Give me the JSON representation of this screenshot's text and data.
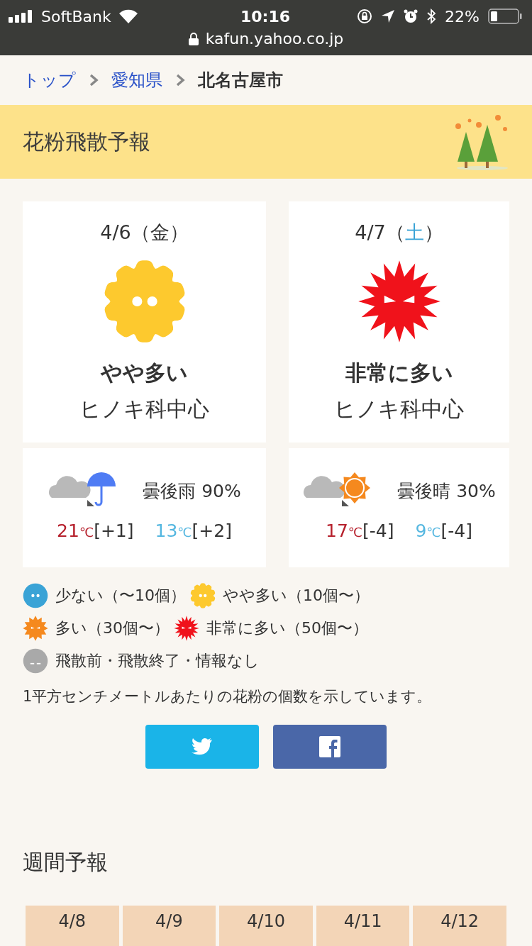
{
  "status_bar": {
    "carrier": "SoftBank",
    "time": "10:16",
    "battery": "22%"
  },
  "address_bar": {
    "url": "kafun.yahoo.co.jp"
  },
  "breadcrumb": [
    {
      "label": "トップ",
      "kind": "link"
    },
    {
      "label": "愛知県",
      "kind": "link"
    },
    {
      "label": "北名古屋市",
      "kind": "current"
    }
  ],
  "section_title": "花粉飛散予報",
  "days": [
    {
      "date_parts": [
        "4/6（",
        "金",
        "）"
      ],
      "weekday": {
        "kind": "weekday"
      },
      "pollen": {
        "kind": "somewhat"
      },
      "level_label": "やや多い",
      "pollen_type": "ヒノキ科中心",
      "weather_icon": {
        "kind": "rain"
      },
      "weather": "曇後雨 90%",
      "high": {
        "value": "21",
        "unit": "℃",
        "diff": "[+1]"
      },
      "low": {
        "value": "13",
        "unit": "℃",
        "diff": "[+2]"
      }
    },
    {
      "date_parts": [
        "4/7（",
        "土",
        "）"
      ],
      "weekday": {
        "kind": "saturday"
      },
      "pollen": {
        "kind": "very_many"
      },
      "level_label": "非常に多い",
      "pollen_type": "ヒノキ科中心",
      "weather_icon": {
        "kind": "sunny"
      },
      "weather": "曇後晴 30%",
      "high": {
        "value": "17",
        "unit": "℃",
        "diff": "[-4]"
      },
      "low": {
        "value": "9",
        "unit": "℃",
        "diff": "[-4]"
      }
    }
  ],
  "legend": [
    [
      {
        "kind": "few",
        "label": "少ない（〜10個）"
      },
      {
        "kind": "somewhat",
        "label": "やや多い（10個〜）"
      }
    ],
    [
      {
        "kind": "many",
        "label": "多い（30個〜）"
      },
      {
        "kind": "very_many",
        "label": "非常に多い（50個〜）"
      }
    ],
    [
      {
        "kind": "none",
        "label": "飛散前・飛散終了・情報なし"
      }
    ]
  ],
  "note": "1平方センチメートルあたりの花粉の個数を示しています。",
  "share_buttons": [
    {
      "kind": "twitter"
    },
    {
      "kind": "facebook"
    }
  ],
  "weekly_title": "週間予報",
  "weekly_dates": [
    "4/8",
    "4/9",
    "4/10",
    "4/11",
    "4/12"
  ]
}
